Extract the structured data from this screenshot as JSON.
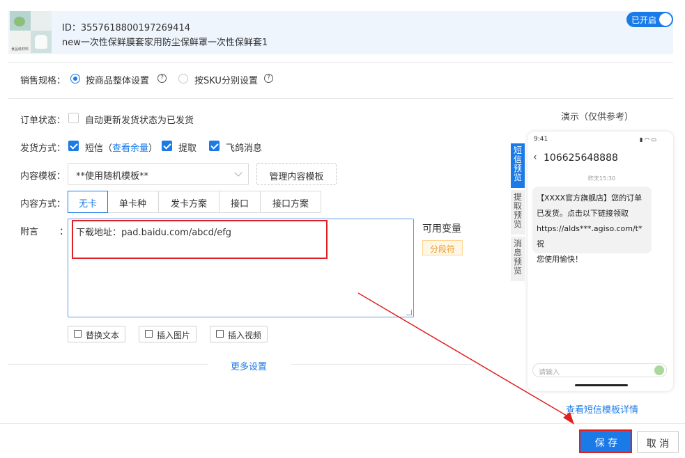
{
  "product": {
    "id": "ID：3557618800197269414",
    "title": "new一次性保鲜膜套家用防尘保鲜罩一次性保鲜套1",
    "thumb_caption": "食品级材料",
    "toggle_label": "已开启"
  },
  "sales_spec": {
    "label": "销售规格：",
    "options": [
      "按商品整体设置",
      "按SKU分别设置"
    ],
    "selected": "按商品整体设置"
  },
  "order_status": {
    "label": "订单状态：",
    "checkbox_label": "自动更新发货状态为已发货"
  },
  "delivery": {
    "label": "发货方式：",
    "sms_label": "短信",
    "sms_link_prefix": "（",
    "sms_link": "查看余量",
    "sms_link_suffix": "）",
    "pickup_label": "提取",
    "feige_label": "飞鸽消息"
  },
  "template": {
    "label": "内容模板：",
    "selected": "**使用随机模板**",
    "manage_button": "管理内容模板"
  },
  "content_mode": {
    "label": "内容方式：",
    "tabs": [
      "无卡",
      "单卡种",
      "发卡方案",
      "接口",
      "接口方案"
    ],
    "active": "无卡"
  },
  "note": {
    "label": "附言",
    "colon": "：",
    "text": "下载地址：pad.baidu.com/abcd/efg",
    "variables_label": "可用变量",
    "segment_tag": "分段符",
    "buttons": [
      "替换文本",
      "插入图片",
      "插入视频"
    ]
  },
  "more_settings": "更多设置",
  "preview": {
    "title": "演示（仅供参考）",
    "tabs": [
      "短信预览",
      "提取预览",
      "消息预览"
    ],
    "active_tab": "短信预览",
    "time": "9:41",
    "sender": "106625648888",
    "timestamp": "昨天15:30",
    "message_lines": [
      "【XXXX官方旗舰店】您的订单",
      "已发货。点击以下链接领取",
      "https://alds***.agiso.com/t*祝",
      "您使用愉快！"
    ],
    "input_placeholder": "请输入",
    "details_link": "查看短信模板详情"
  },
  "footer": {
    "save": "保 存",
    "cancel": "取 消"
  },
  "colors": {
    "primary": "#1a7ae8",
    "annotation_red": "#e02020",
    "header_bg": "#eef5fd"
  }
}
